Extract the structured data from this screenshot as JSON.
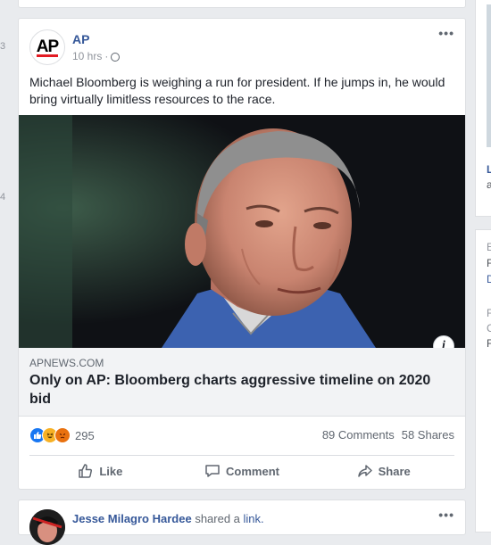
{
  "post": {
    "page_name": "AP",
    "avatar_text": "AP",
    "time": "10 hrs",
    "separator": "·",
    "more": "•••",
    "text": "Michael Bloomberg is weighing a run for president. If he jumps in, he would bring virtually limitless resources to the race.",
    "info": "i",
    "link": {
      "domain": "APNEWS.COM",
      "title": "Only on AP: Bloomberg charts aggressive timeline on 2020 bid"
    },
    "reactions": {
      "count": "295",
      "types": [
        "like",
        "haha",
        "angry"
      ]
    },
    "comments": "89 Comments",
    "shares": "58 Shares",
    "actions": {
      "like": "Like",
      "comment": "Comment",
      "share": "Share"
    }
  },
  "next_post": {
    "author": "Jesse Milagro Hardee",
    "action_text": "shared a",
    "link_text": "link.",
    "more": "•••"
  },
  "right_rail": {
    "t1": "L",
    "t2": "a",
    "t3": "E",
    "t4": "F",
    "t5": "D",
    "t6": "F",
    "t7": "C",
    "t8": "F"
  },
  "left_edge": {
    "m1": "3",
    "m2": "4"
  },
  "colors": {
    "link": "#365899",
    "like_blue": "#1877f2",
    "background": "#e9ebee"
  }
}
